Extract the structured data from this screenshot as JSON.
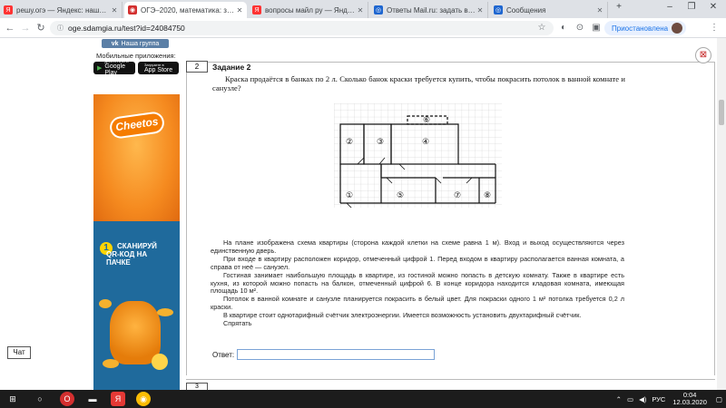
{
  "browser": {
    "tabs": [
      {
        "label": "решу.огэ — Яндекс: нашлось",
        "favicon": "Я",
        "favicon_color": "#ff3333",
        "active": false
      },
      {
        "label": "ОГЭ–2020, математика: зада",
        "favicon": "◉",
        "favicon_color": "#d32f2f",
        "active": true
      },
      {
        "label": "вопросы майл ру — Яндекс",
        "favicon": "Я",
        "favicon_color": "#ff3333",
        "active": false
      },
      {
        "label": "Ответы Mail.ru: задать вопрос",
        "favicon": "◎",
        "favicon_color": "#1e66d0",
        "active": false
      },
      {
        "label": "Сообщения",
        "favicon": "◎",
        "favicon_color": "#1e66d0",
        "active": false
      }
    ],
    "url": "oge.sdamgia.ru/test?id=24084750",
    "profile_label": "Приостановлена"
  },
  "sidebar": {
    "vk_button": "Наша группа",
    "mobile_apps_label": "Мобильные приложения:",
    "stores": [
      {
        "top": "ДОСТУПНО В",
        "name": "Google Play"
      },
      {
        "top": "Загрузите в",
        "name": "App Store"
      }
    ],
    "ad": {
      "brand": "Cheetos",
      "step_number": "1",
      "line1": "СКАНИРУЙ",
      "line2": "QR-КОД НА ПАЧКЕ"
    },
    "chat_button": "Чат"
  },
  "task": {
    "number": "2",
    "title": "Задание 2",
    "question": "Краска продаётся в банках по 2 л. Сколько банок краски требуется купить, чтобы покрасить потолок в ванной комнате и санузле?",
    "plan_labels": [
      "①",
      "②",
      "③",
      "④",
      "⑤",
      "⑥",
      "⑦",
      "⑧"
    ],
    "paragraphs": [
      "На плане изображена схема квартиры (сторона каждой клетки на схеме равна 1 м). Вход и выход осуществляются через единственную дверь.",
      "При входе в квартиру расположен коридор, отмеченный цифрой 1. Перед входом в квартиру располагается ванная комната, а справа от неё — санузел.",
      "Гостиная занимает наибольшую площадь в квартире, из гостиной можно попасть в детскую комнату. Также в квартире есть кухня, из которой можно попасть на балкон, отмеченный цифрой 6. В конце коридора находится кладовая комната, имеющая площадь 10 м².",
      "Потолок в ванной комнате и санузле планируется покрасить в белый цвет. Для покраски одного 1 м² потолка требуется 0,2 л краски.",
      "В квартире стоит однотарифный счётчик электроэнергии. Имеется возможность установить двухтарифный счётчик."
    ],
    "hide_link": "Спрятать",
    "answer_label": "Ответ:",
    "answer_value": "",
    "next_number": "3"
  },
  "taskbar": {
    "language": "РУС",
    "time": "0:04",
    "date": "12.03.2020"
  }
}
